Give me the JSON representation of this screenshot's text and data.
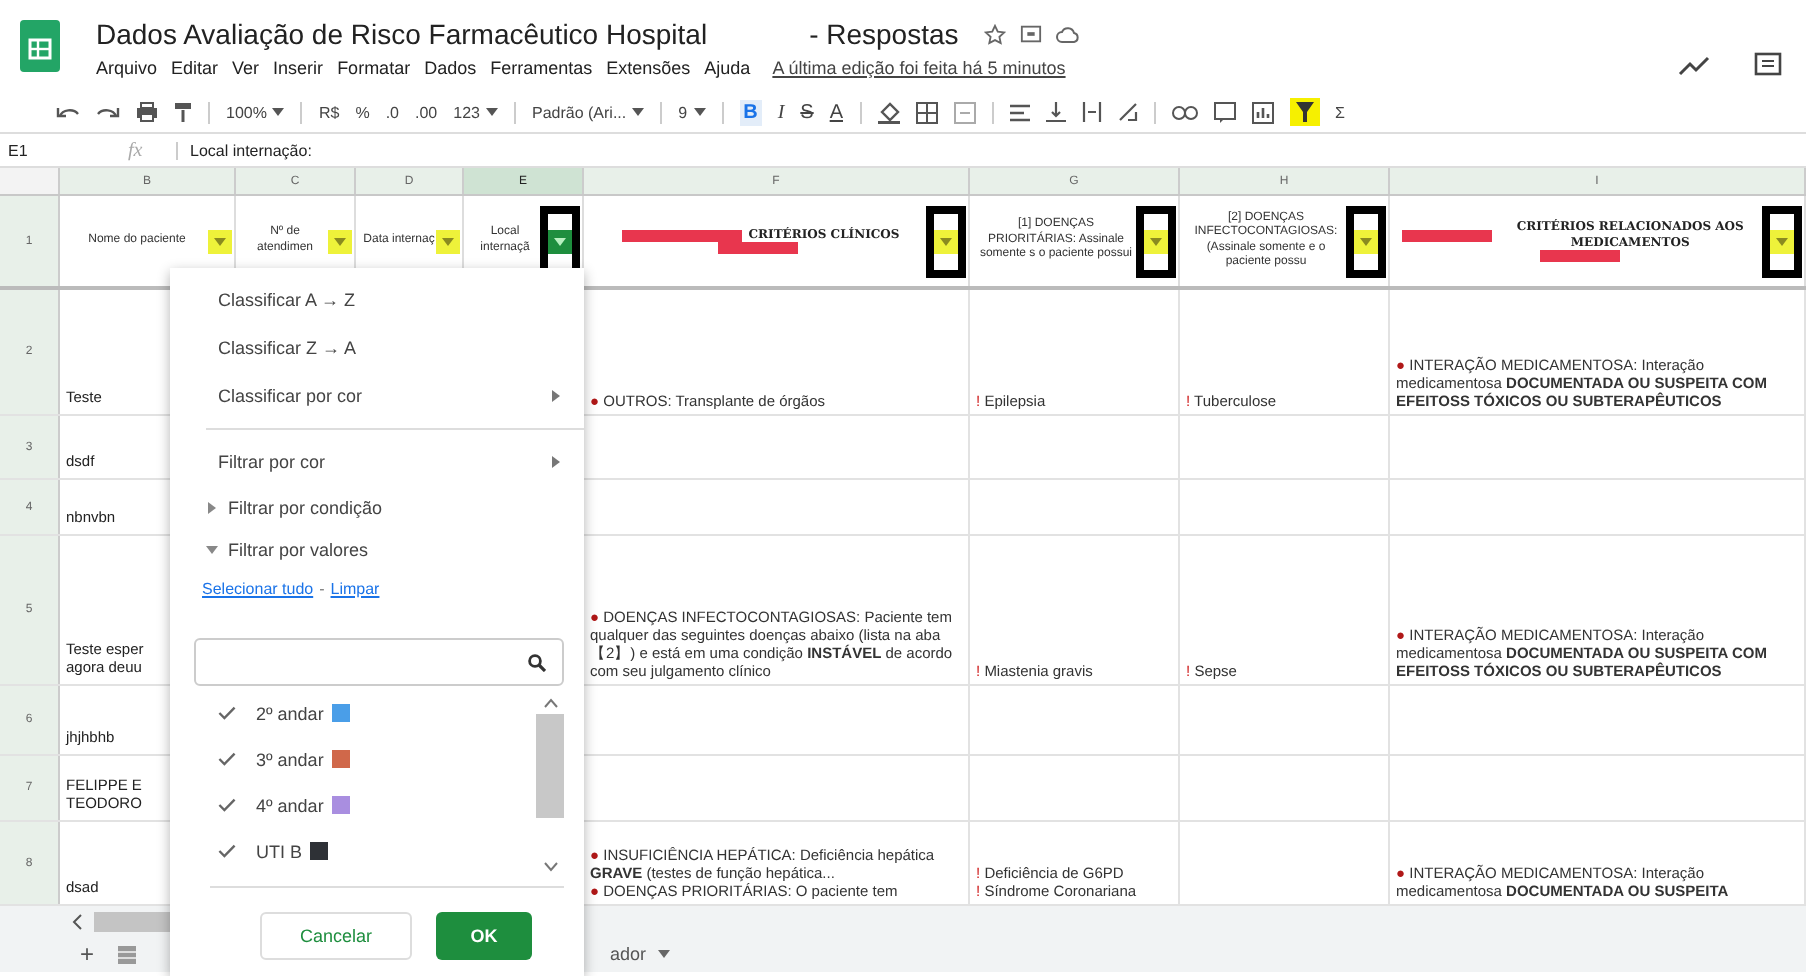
{
  "app": {
    "title": "Dados Avaliação de Risco Farmacêutico Hospital",
    "subtitle": "- Respostas",
    "menus": [
      "Arquivo",
      "Editar",
      "Ver",
      "Inserir",
      "Formatar",
      "Dados",
      "Ferramentas",
      "Extensões",
      "Ajuda"
    ],
    "last_edit": "A última edição foi feita há 5 minutos"
  },
  "toolbar": {
    "zoom": "100%",
    "currency": "R$",
    "percent": "%",
    "decrease_decimals": ".0",
    "increase_decimals": ".00",
    "number_format": "123",
    "font": "Padrão (Ari...",
    "font_size": "9",
    "bold": "B",
    "italic": "I",
    "strikethrough": "S",
    "text_color": "A",
    "functions": "Σ",
    "filter_on": true
  },
  "formula_bar": {
    "cell": "E1",
    "fx": "fx",
    "value": "Local internação:"
  },
  "columns": [
    {
      "letter": "B",
      "selected": false
    },
    {
      "letter": "C",
      "selected": false
    },
    {
      "letter": "D",
      "selected": false
    },
    {
      "letter": "E",
      "selected": true
    },
    {
      "letter": "F",
      "selected": false
    },
    {
      "letter": "G",
      "selected": false
    },
    {
      "letter": "H",
      "selected": false
    },
    {
      "letter": "I",
      "selected": false
    }
  ],
  "header_row": {
    "number": "1",
    "cells": [
      {
        "kind": "label",
        "text": "Nome do paciente",
        "filter_active": false,
        "outlined": false
      },
      {
        "kind": "label",
        "text": "Nº de atendimen",
        "filter_active": false,
        "outlined": false
      },
      {
        "kind": "label",
        "text": "Data internaç",
        "filter_active": false,
        "outlined": false
      },
      {
        "kind": "label",
        "text": "Local internaçã",
        "filter_active": true,
        "outlined": true
      },
      {
        "kind": "redacted_heading",
        "text": "CRITÉRIOS CLÍNICOS",
        "filter_active": false,
        "outlined": true
      },
      {
        "kind": "label",
        "text": "[1] DOENÇAS PRIORITÁRIAS: Assinale somente s o paciente possui",
        "filter_active": false,
        "outlined": true
      },
      {
        "kind": "label",
        "text": "[2] DOENÇAS INFECTOCONTAGIOSAS: (Assinale somente e o paciente possu",
        "filter_active": false,
        "outlined": true
      },
      {
        "kind": "redacted_heading",
        "text": "CRITÉRIOS RELACIONADOS AOS MEDICAMENTOS",
        "filter_active": false,
        "outlined": true
      }
    ]
  },
  "rows": [
    {
      "number": "2",
      "name": "Teste",
      "clinical": [
        {
          "mark": "●",
          "text": "OUTROS: Transplante de órgãos"
        }
      ],
      "priority": [
        {
          "mark": "!",
          "text": "Epilepsia"
        }
      ],
      "infectious": [
        {
          "mark": "!",
          "text": "Tuberculose"
        }
      ],
      "drug": [
        {
          "mark": "●",
          "text": "INTERAÇÃO MEDICAMENTOSA: Interação medicamentosa **DOCUMENTADA OU SUSPEITA COM EFEITOSS TÓXICOS OU SUBTERAPÊUTICOS**"
        }
      ]
    },
    {
      "number": "3",
      "name": "dsdf",
      "clinical": [],
      "priority": [],
      "infectious": [],
      "drug": []
    },
    {
      "number": "4",
      "name": "nbnvbn",
      "clinical": [],
      "priority": [],
      "infectious": [],
      "drug": []
    },
    {
      "number": "5",
      "name": "Teste esper agora deuu",
      "clinical": [
        {
          "mark": "●",
          "text": "DOENÇAS INFECTOCONTAGIOSAS: Paciente tem qualquer das seguintes doenças abaixo (lista na aba【2】) e está em uma condição **INSTÁVEL** de acordo com seu julgamento clínico"
        }
      ],
      "priority": [
        {
          "mark": "!",
          "text": "Miastenia gravis"
        }
      ],
      "infectious": [
        {
          "mark": "!",
          "text": "Sepse"
        }
      ],
      "drug": [
        {
          "mark": "●",
          "text": "INTERAÇÃO MEDICAMENTOSA: Interação medicamentosa **DOCUMENTADA OU SUSPEITA COM EFEITOSS TÓXICOS OU SUBTERAPÊUTICOS**"
        }
      ]
    },
    {
      "number": "6",
      "name": "jhjhbhb",
      "clinical": [],
      "priority": [],
      "infectious": [],
      "drug": []
    },
    {
      "number": "7",
      "name": "FELIPPE E TEODORO",
      "clinical": [],
      "priority": [],
      "infectious": [],
      "drug": []
    },
    {
      "number": "8",
      "name": "dsad",
      "clinical": [
        {
          "mark": "●",
          "text": "INSUFICIÊNCIA HEPÁTICA: Deficiência hepática **GRAVE** (testes de função hepática..."
        },
        {
          "mark": "●",
          "text": "DOENÇAS PRIORITÁRIAS: O paciente tem"
        }
      ],
      "priority": [
        {
          "mark": "!",
          "text": "Deficiência de G6PD"
        },
        {
          "mark": "!",
          "text": "Síndrome Coronariana"
        }
      ],
      "infectious": [],
      "drug": [
        {
          "mark": "●",
          "text": "INTERAÇÃO MEDICAMENTOSA: Interação medicamentosa **DOCUMENTADA OU SUSPEITA**"
        }
      ]
    }
  ],
  "sheet_tabs": {
    "add": "+",
    "tab": "ador"
  },
  "filter_menu": {
    "sort": [
      {
        "text": "Classificar A → Z",
        "submenu": false
      },
      {
        "text": "Classificar Z → A",
        "submenu": false
      },
      {
        "text": "Classificar por cor",
        "submenu": true
      }
    ],
    "filters": [
      {
        "text": "Filtrar por cor",
        "kind": "submenu"
      },
      {
        "text": "Filtrar por condição",
        "kind": "section",
        "expanded": false
      },
      {
        "text": "Filtrar por valores",
        "kind": "section",
        "expanded": true
      }
    ],
    "select_all": "Selecionar tudo",
    "separator": "-",
    "clear": "Limpar",
    "values": [
      {
        "text": "2º andar",
        "checked": true,
        "color": "#4a9ee8"
      },
      {
        "text": "3º andar",
        "checked": true,
        "color": "#d0684a"
      },
      {
        "text": "4º andar",
        "checked": true,
        "color": "#a98ee0"
      },
      {
        "text": "UTI B",
        "checked": true,
        "color": "#2e3136"
      }
    ],
    "cancel": "Cancelar",
    "ok": "OK"
  }
}
